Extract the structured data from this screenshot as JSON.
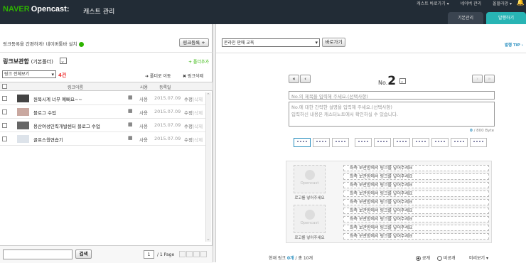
{
  "header": {
    "brand_naver": "NAVER",
    "brand_opencast": "Opencast:",
    "page_title": "캐스트 관리",
    "links": [
      "캐스트 바로가기 ▾",
      "네이버 관리",
      "올할라망 ▾"
    ],
    "tabs": [
      "기본관리",
      "발행하기"
    ]
  },
  "left": {
    "notice": "링크등록을 간편하게! 네이버툴바 설치",
    "register_button": "링크등록 +",
    "folder_title": "링크보관함",
    "folder_sub": "(기본폴더)",
    "add_folder": "+ 폴더추가",
    "filter_select": "링크 전체보기",
    "count": "4건",
    "move_folder": "➔ 폴더로 이동",
    "delete_link": "✖ 링크삭제",
    "columns": [
      "링크이름",
      "사용",
      "등록일"
    ],
    "rows": [
      {
        "title": "원목시계 너무 예뻐요~~",
        "use": "사용",
        "date": "2015.07.09",
        "action": "수정",
        "action2": "|삭제"
      },
      {
        "title": "블로그 수업",
        "use": "사용",
        "date": "2015.07.09",
        "action": "수정",
        "action2": "|삭제"
      },
      {
        "title": "용산여성인력개발센터 블로그 수업",
        "use": "사용",
        "date": "2015.07.09",
        "action": "수정",
        "action2": "|삭제"
      },
      {
        "title": "골프스윙연습기",
        "use": "사용",
        "date": "2015.07.09",
        "action": "수정",
        "action2": "|삭제"
      }
    ],
    "search_button": "검색",
    "page_current": "1",
    "page_total": "/ 1 Page"
  },
  "right": {
    "cast_select": "온라인 판매 교육",
    "goto_button": "바로가기",
    "tip": "발행 TIP ›",
    "no_label": "No.",
    "no_value": "2",
    "title_placeholder": "No.의 제목을 입력해 주세요.(선택사항)",
    "desc_line1": "No.에 대한 간략한 설명을 입력해 주세요.(선택사항)",
    "desc_line2": "입력하신 내용은 캐스터노트에서 확인하실 수 있습니다.",
    "byte_used": "0",
    "byte_total": "/ 800 Byte",
    "placeholder_logo": "Opencast",
    "placeholder_label": "로고를 넣어주세요",
    "link_placeholder": "좌측 보관함에서 링크를 넣어주세요",
    "footer_links_label": "현재 링크",
    "footer_links_count": "0개",
    "footer_links_total": "/ 총 10개",
    "radio_public": "공개",
    "radio_private": "비공개",
    "preview": "미리보기 ▾"
  }
}
